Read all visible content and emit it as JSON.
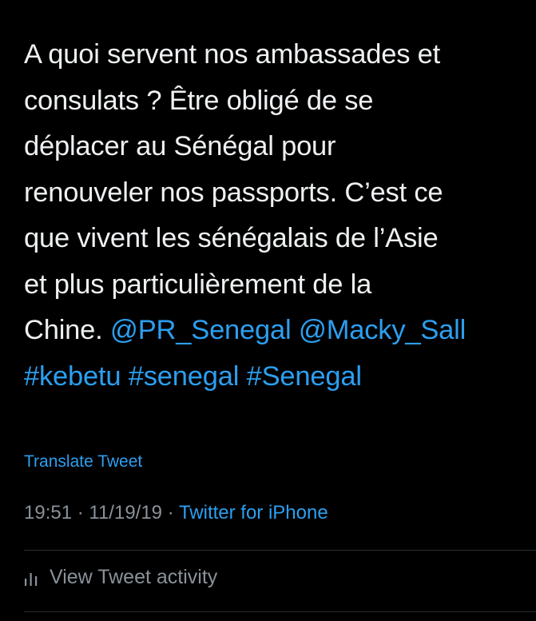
{
  "tweet": {
    "lines": [
      "A quoi servent nos ambassades et",
      "consulats ? Être obligé de se",
      "déplacer au Sénégal pour",
      "renouveler nos passports. C’est ce",
      "que vivent les sénégalais de l’Asie",
      "et plus particulièrement de la"
    ],
    "last_line_text": "Chine. ",
    "mention_1": "@PR_Senegal",
    "mention_2": "@Macky_Sall",
    "hashtag_1": "#kebetu",
    "hashtag_2": "#senegal",
    "hashtag_3": "#Senegal"
  },
  "translate_label": "Translate Tweet",
  "meta": {
    "time": "19:51",
    "separator": " · ",
    "date": "11/19/19",
    "source": "Twitter for iPhone"
  },
  "activity": {
    "icon": "bar-chart-icon",
    "label": "View Tweet activity"
  },
  "colors": {
    "background": "#000000",
    "text": "#eef0f2",
    "link": "#2c9ff0",
    "muted": "#8a9199"
  }
}
